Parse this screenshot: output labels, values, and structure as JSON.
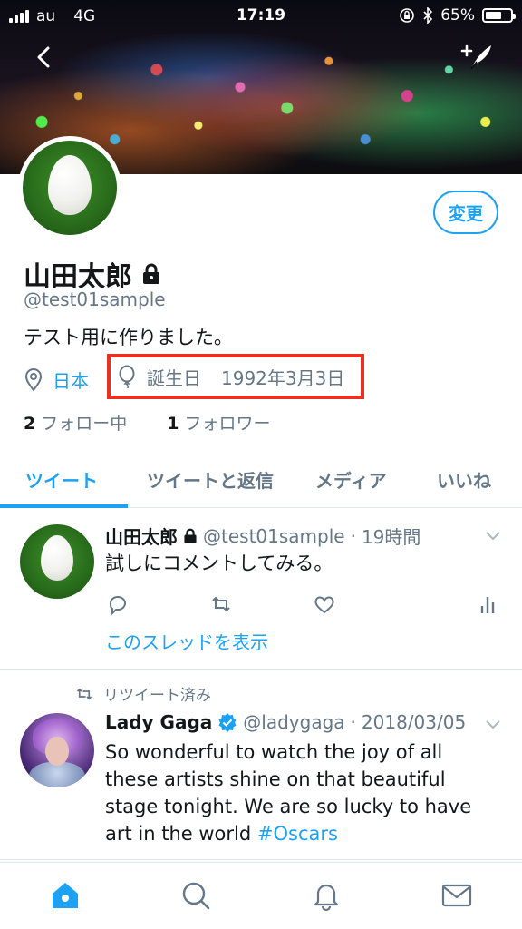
{
  "status_bar": {
    "carrier": "au",
    "network": "4G",
    "time": "17:19",
    "battery": "65%",
    "battery_level": 0.65
  },
  "profile": {
    "edit_button": "変更",
    "name": "山田太郎",
    "handle": "@test01sample",
    "bio": "テスト用に作りました。",
    "location": "日本",
    "birthday_label": "誕生日",
    "birthday_value": "1992年3月3日",
    "following_count": "2",
    "following_label": "フォロー中",
    "followers_count": "1",
    "followers_label": "フォロワー"
  },
  "tabs": [
    {
      "label": "ツイート",
      "active": true
    },
    {
      "label": "ツイートと返信",
      "active": false
    },
    {
      "label": "メディア",
      "active": false
    },
    {
      "label": "いいね",
      "active": false
    }
  ],
  "tweets": [
    {
      "name": "山田太郎",
      "handle": "@test01sample",
      "separator": "·",
      "time": "19時間",
      "text": "試しにコメントしてみる。",
      "thread_link": "このスレッドを表示"
    },
    {
      "retweet_label": "リツイート済み",
      "name": "Lady Gaga",
      "handle": "@ladygaga",
      "separator": "·",
      "time": "2018/03/05",
      "text_lines": [
        "So wonderful to watch the joy of all",
        "these artists shine on that beautiful",
        "stage tonight. We are so lucky to have",
        "art in the world "
      ],
      "hashtag": "#Oscars"
    }
  ],
  "colors": {
    "accent": "#1da1f2",
    "highlight": "#e53223",
    "secondary_text": "#657786"
  }
}
